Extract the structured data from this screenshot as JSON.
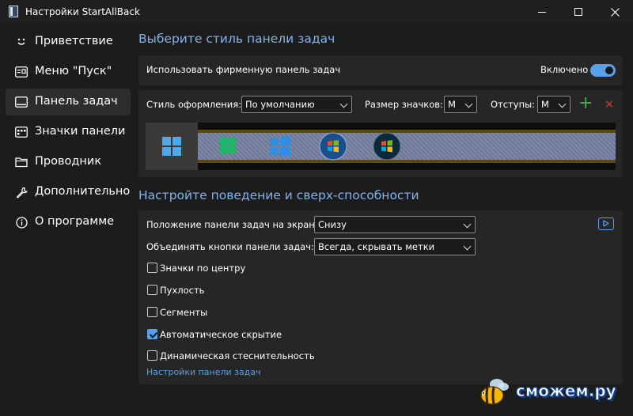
{
  "window": {
    "title": "Настройки StartAllBack"
  },
  "sidebar": {
    "items": [
      {
        "label": "Приветствие",
        "icon": "smile-icon"
      },
      {
        "label": "Меню \"Пуск\"",
        "icon": "start-menu-icon"
      },
      {
        "label": "Панель задач",
        "icon": "taskbar-icon"
      },
      {
        "label": "Значки панели",
        "icon": "tray-icons-icon"
      },
      {
        "label": "Проводник",
        "icon": "folder-icon"
      },
      {
        "label": "Дополнительно",
        "icon": "wrench-icon"
      },
      {
        "label": "О программе",
        "icon": "info-icon"
      }
    ],
    "active_index": 2
  },
  "section1": {
    "title": "Выберите стиль панели задач",
    "use_taskbar_label": "Использовать фирменную панель задач",
    "toggle_label": "Включено",
    "toggle_on": true,
    "style_label": "Стиль оформления:",
    "style_value": "По умолчанию",
    "icon_size_label": "Размер значков:",
    "icon_size_value": "M",
    "padding_label": "Отступы:",
    "padding_value": "M",
    "add_symbol": "+",
    "remove_symbol": "✕"
  },
  "section2": {
    "title": "Настройте поведение и сверх-способности",
    "position_label": "Положение панели задач на экране:",
    "position_value": "Снизу",
    "combine_label": "Объединять кнопки панели задач:",
    "combine_value": "Всегда, скрывать метки",
    "checkboxes": [
      {
        "label": "Значки по центру",
        "checked": false
      },
      {
        "label": "Пухлость",
        "checked": false
      },
      {
        "label": "Сегменты",
        "checked": false
      },
      {
        "label": "Автоматическое скрытие",
        "checked": true
      },
      {
        "label": "Динамическая стеснительность",
        "checked": false
      }
    ],
    "link_label": "Настройки панели задач"
  },
  "watermark": {
    "text": "сможем.ру"
  },
  "colors": {
    "accent": "#5aa0e8",
    "heading": "#7fb4ef",
    "background": "#1c1c1c",
    "panel": "#262626"
  }
}
